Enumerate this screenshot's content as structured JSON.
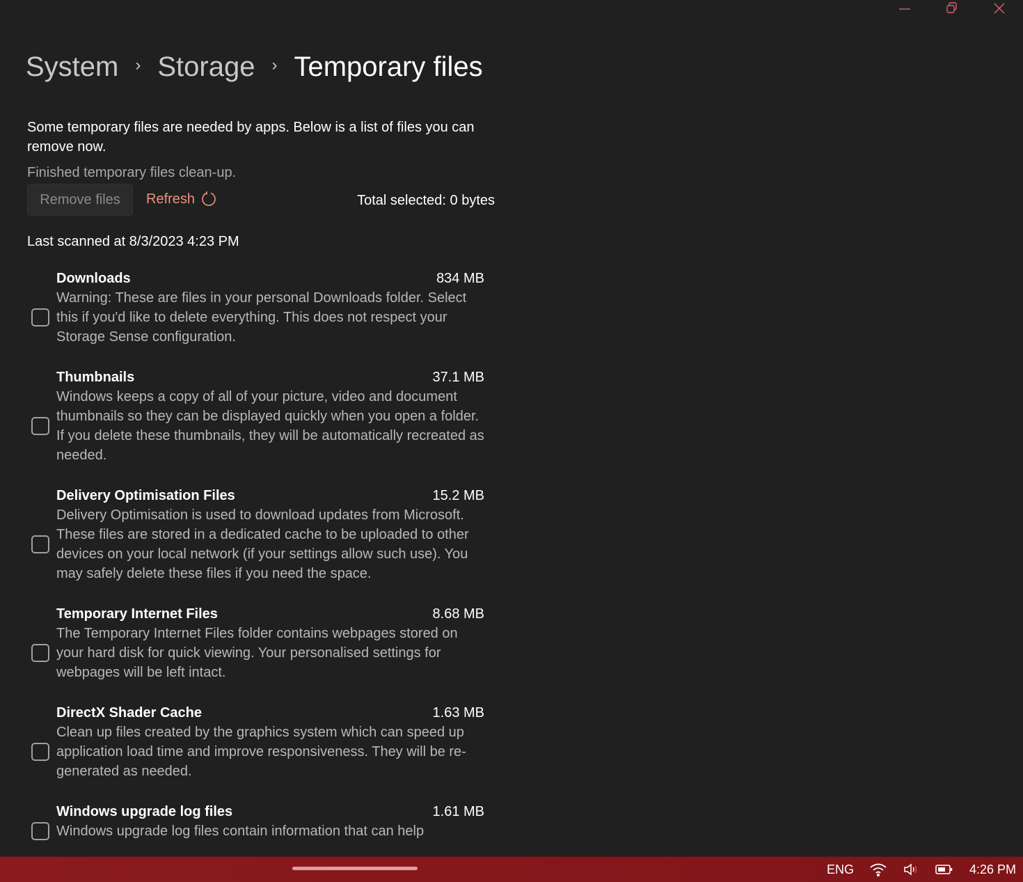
{
  "window": {
    "controls": {
      "minimize": "minimize",
      "restore": "restore",
      "close": "close"
    },
    "accent": "#e06070"
  },
  "breadcrumb": {
    "items": [
      "System",
      "Storage"
    ],
    "current": "Temporary files",
    "separator": "›"
  },
  "intro": "Some temporary files are needed by apps. Below is a list of files you can remove now.",
  "status": "Finished temporary files clean-up.",
  "actions": {
    "remove_label": "Remove files",
    "refresh_label": "Refresh",
    "total_selected": "Total selected: 0 bytes"
  },
  "last_scanned": "Last scanned at 8/3/2023 4:23 PM",
  "items": [
    {
      "name": "Downloads",
      "size": "834 MB",
      "checked": false,
      "description": "Warning: These are files in your personal Downloads folder. Select this if you'd like to delete everything. This does not respect your Storage Sense configuration."
    },
    {
      "name": "Thumbnails",
      "size": "37.1 MB",
      "checked": false,
      "description": "Windows keeps a copy of all of your picture, video and document thumbnails so they can be displayed quickly when you open a folder. If you delete these thumbnails, they will be automatically recreated as needed."
    },
    {
      "name": "Delivery Optimisation Files",
      "size": "15.2 MB",
      "checked": false,
      "description": "Delivery Optimisation is used to download updates from Microsoft. These files are stored in a dedicated cache to be uploaded to other devices on your local network (if your settings allow such use). You may safely delete these files if you need the space."
    },
    {
      "name": "Temporary Internet Files",
      "size": "8.68 MB",
      "checked": false,
      "description": "The Temporary Internet Files folder contains webpages stored on your hard disk for quick viewing. Your personalised settings for webpages will be left intact."
    },
    {
      "name": "DirectX Shader Cache",
      "size": "1.63 MB",
      "checked": false,
      "description": "Clean up files created by the graphics system which can speed up application load time and improve responsiveness. They will be re-generated as needed."
    },
    {
      "name": "Windows upgrade log files",
      "size": "1.61 MB",
      "checked": false,
      "description": "Windows upgrade log files contain information that can help"
    }
  ],
  "taskbar": {
    "language": "ENG",
    "time": "4:26 PM",
    "icons": [
      "wifi-icon",
      "volume-icon",
      "battery-icon"
    ]
  }
}
